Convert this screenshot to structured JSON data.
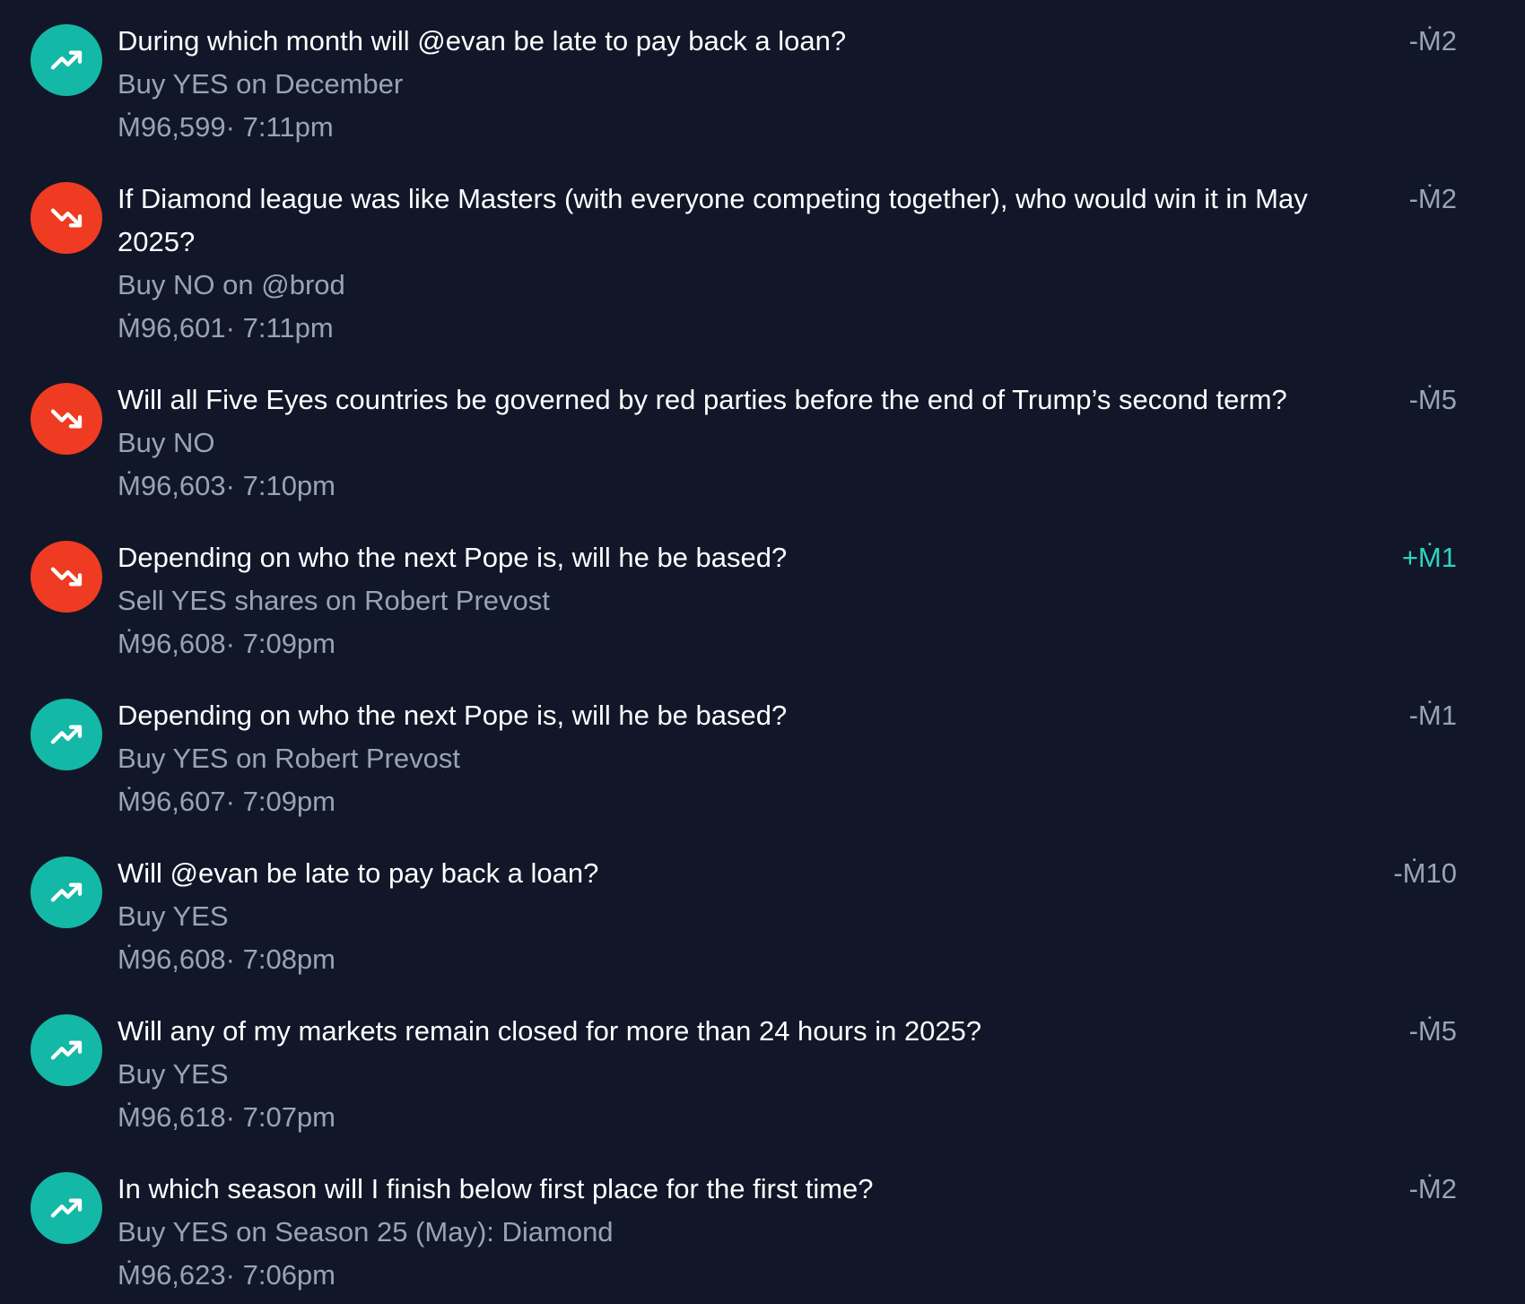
{
  "feed": {
    "items": [
      {
        "direction": "up",
        "icon": "trending-up-icon",
        "question": "During which month will @evan be late to pay back a loan?",
        "action": "Buy YES on December",
        "balance": "Ṁ96,599",
        "separator": "·",
        "time": "7:11pm",
        "amount": "-Ṁ2"
      },
      {
        "direction": "down",
        "icon": "trending-down-icon",
        "question": "If Diamond league was like Masters (with everyone competing together), who would win it in May 2025?",
        "action": "Buy NO on @brod",
        "balance": "Ṁ96,601",
        "separator": "·",
        "time": "7:11pm",
        "amount": "-Ṁ2"
      },
      {
        "direction": "down",
        "icon": "trending-down-icon",
        "question": "Will all Five Eyes countries be governed by red parties before the end of Trump’s second term?",
        "action": "Buy NO",
        "balance": "Ṁ96,603",
        "separator": "·",
        "time": "7:10pm",
        "amount": "-Ṁ5"
      },
      {
        "direction": "down",
        "icon": "trending-down-icon",
        "question": "Depending on who the next Pope is, will he be based?",
        "action": "Sell YES shares on Robert Prevost",
        "balance": "Ṁ96,608",
        "separator": "·",
        "time": "7:09pm",
        "amount": "+Ṁ1"
      },
      {
        "direction": "up",
        "icon": "trending-up-icon",
        "question": "Depending on who the next Pope is, will he be based?",
        "action": "Buy YES on Robert Prevost",
        "balance": "Ṁ96,607",
        "separator": "·",
        "time": "7:09pm",
        "amount": "-Ṁ1"
      },
      {
        "direction": "up",
        "icon": "trending-up-icon",
        "question": "Will @evan be late to pay back a loan?",
        "action": "Buy YES",
        "balance": "Ṁ96,608",
        "separator": "·",
        "time": "7:08pm",
        "amount": "-Ṁ10"
      },
      {
        "direction": "up",
        "icon": "trending-up-icon",
        "question": "Will any of my markets remain closed for more than 24 hours in 2025?",
        "action": "Buy YES",
        "balance": "Ṁ96,618",
        "separator": "·",
        "time": "7:07pm",
        "amount": "-Ṁ5"
      },
      {
        "direction": "up",
        "icon": "trending-up-icon",
        "question": "In which season will I finish below first place for the first time?",
        "action": "Buy YES on Season 25 (May): Diamond",
        "balance": "Ṁ96,623",
        "separator": "·",
        "time": "7:06pm",
        "amount": "-Ṁ2"
      }
    ]
  },
  "colors": {
    "background": "#111729",
    "up": "#14b8a6",
    "down": "#ef3b22",
    "muted_text": "#9aa3b5",
    "positive_amount": "#2dd4bf"
  }
}
